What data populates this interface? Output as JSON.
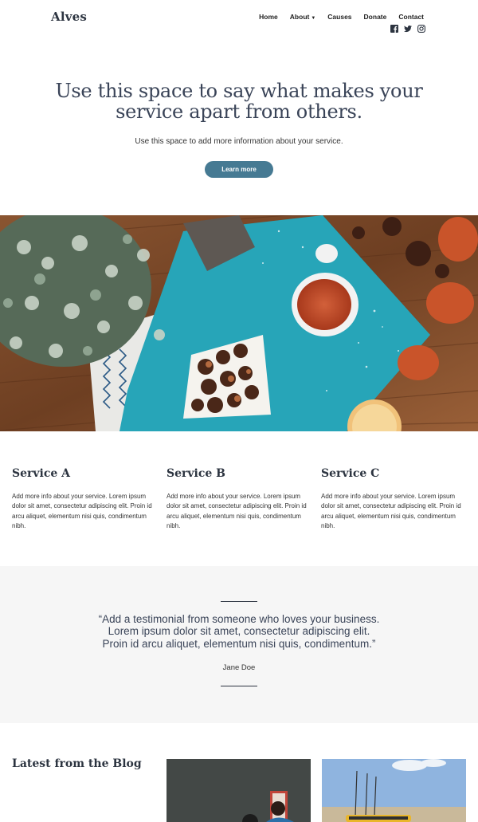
{
  "header": {
    "logo": "Alves",
    "nav": [
      "Home",
      "About",
      "Causes",
      "Donate",
      "Contact"
    ],
    "about_has_dropdown": true,
    "social_icons": [
      "facebook-icon",
      "twitter-icon",
      "instagram-icon"
    ]
  },
  "hero": {
    "title_line1": "Use this space to say what makes your",
    "title_line2": "service apart from others.",
    "subtitle": "Use this space to add more information about your service.",
    "button_label": "Learn more"
  },
  "services": [
    {
      "title": "Service A",
      "text": "Add more info about your service. Lorem ipsum dolor sit amet, consectetur adipiscing elit. Proin id arcu aliquet, elementum nisi quis, condimentum nibh."
    },
    {
      "title": "Service B",
      "text": "Add more info about your service. Lorem ipsum dolor sit amet, consectetur adipiscing elit. Proin id arcu aliquet, elementum nisi quis, condimentum nibh."
    },
    {
      "title": "Service C",
      "text": "Add more info about your service. Lorem ipsum dolor sit amet, consectetur adipiscing elit. Proin id arcu aliquet, elementum nisi quis, condimentum nibh."
    }
  ],
  "testimonial": {
    "line1": "“Add a testimonial from someone who loves your business.",
    "line2": "Lorem ipsum dolor sit amet, consectetur adipiscing elit.",
    "line3": "Proin id arcu aliquet, elementum nisi quis, condimentum.”",
    "author": "Jane Doe"
  },
  "blog": {
    "title": "Latest from the Blog"
  },
  "colors": {
    "accent": "#467a93",
    "heading": "#3a4458",
    "testimonial_bg": "#f6f6f6"
  }
}
